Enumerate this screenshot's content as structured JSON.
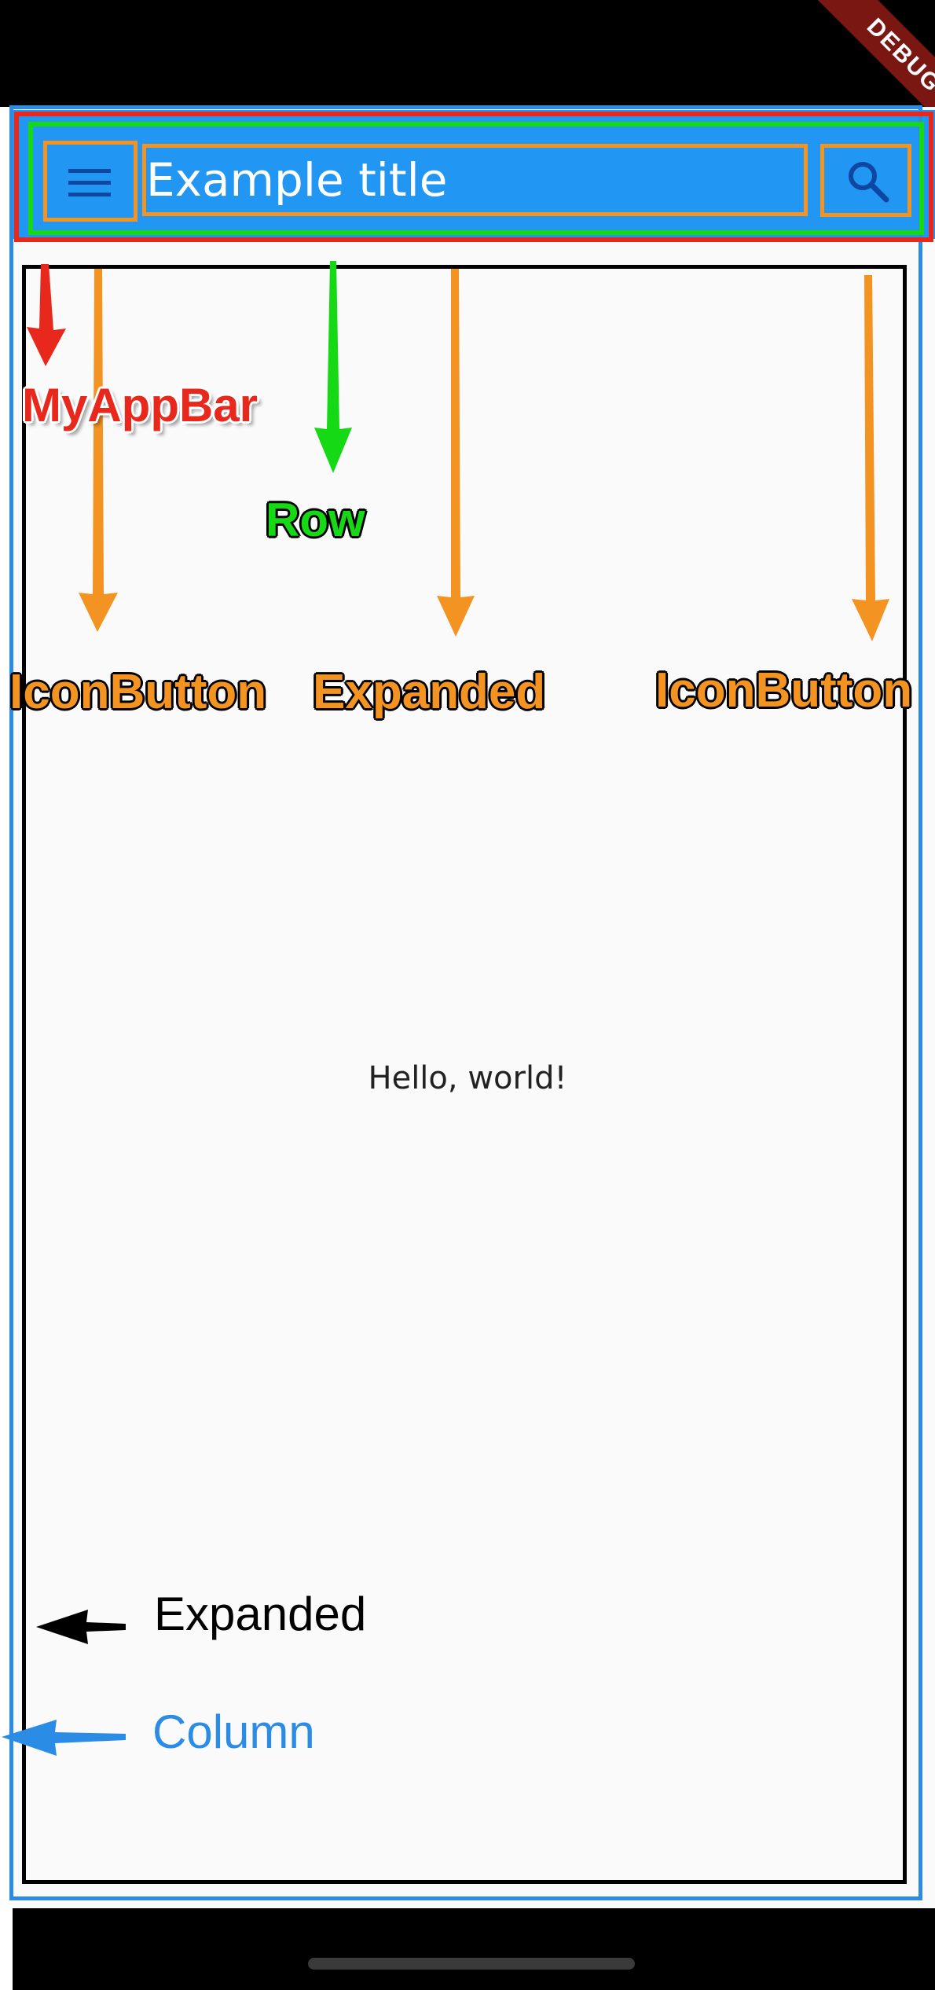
{
  "debug_banner": "DEBUG",
  "app_bar": {
    "title": "Example title",
    "menu_icon": "menu-icon",
    "search_icon": "search-icon",
    "color": "#2196F3"
  },
  "body": {
    "text": "Hello, world!"
  },
  "annotations": {
    "my_app_bar": "MyAppBar",
    "row": "Row",
    "icon_button_left": "IconButton",
    "expanded_title": "Expanded",
    "icon_button_right": "IconButton",
    "expanded_body": "Expanded",
    "column": "Column"
  },
  "colors": {
    "my_app_bar": "#e8281c",
    "row": "#16d916",
    "widget": "#f39322",
    "expanded_body": "#000000",
    "column": "#2b8ce6"
  }
}
